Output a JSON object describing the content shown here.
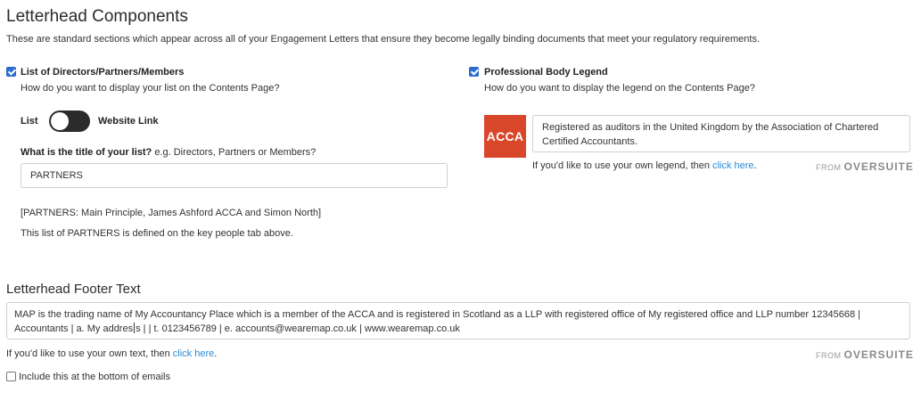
{
  "header": {
    "title": "Letterhead Components",
    "description": "These are standard sections which appear across all of your Engagement Letters that ensure they become legally binding documents that meet your regulatory requirements."
  },
  "directors": {
    "checkbox_label": "List of Directors/Partners/Members",
    "checked": true,
    "question": "How do you want to display your list on the Contents Page?",
    "toggle_left": "List",
    "toggle_right": "Website Link",
    "title_question_bold": "What is the title of your list?",
    "title_question_hint": " e.g. Directors, Partners or Members?",
    "title_value": "PARTNERS",
    "list_summary": "[PARTNERS: Main Principle, James Ashford ACCA and Simon North]",
    "list_note": "This list of PARTNERS is defined on the key people tab above."
  },
  "legend": {
    "checkbox_label": "Professional Body Legend",
    "checked": true,
    "question": "How do you want to display the legend on the Contents Page?",
    "logo_text": "ACCA",
    "logo_color": "#d9472b",
    "text": "Registered as auditors in the United Kingdom by the Association of Chartered Certified Accountants.",
    "own_prefix": "If you'd like to use your own legend, then ",
    "own_link": "click here",
    "own_suffix": ".",
    "brand_from": "FROM",
    "brand_name": "OVERSUITE",
    "brand_tm": "™"
  },
  "footer": {
    "title": "Letterhead Footer Text",
    "text_line1": "MAP is the trading name of My Accountancy Place which is a member of the ACCA and is registered in Scotland as a LLP with registered office of My registered office and LLP number 12345668 |",
    "text_line2_a": "Accountants | a. My addres",
    "text_line2_b": "s | | t. 0123456789 | e. accounts@wearemap.co.uk | www.wearemap.co.uk",
    "own_prefix": "If you'd like to use your own text, then ",
    "own_link": "click here",
    "own_suffix": ".",
    "brand_from": "FROM",
    "brand_name": "OVERSUITE",
    "brand_tm": "™",
    "email_checkbox_label": "Include this at the bottom of emails",
    "email_checked": false
  },
  "colors": {
    "accent": "#2f6fd6",
    "link": "#2a8bd5"
  }
}
